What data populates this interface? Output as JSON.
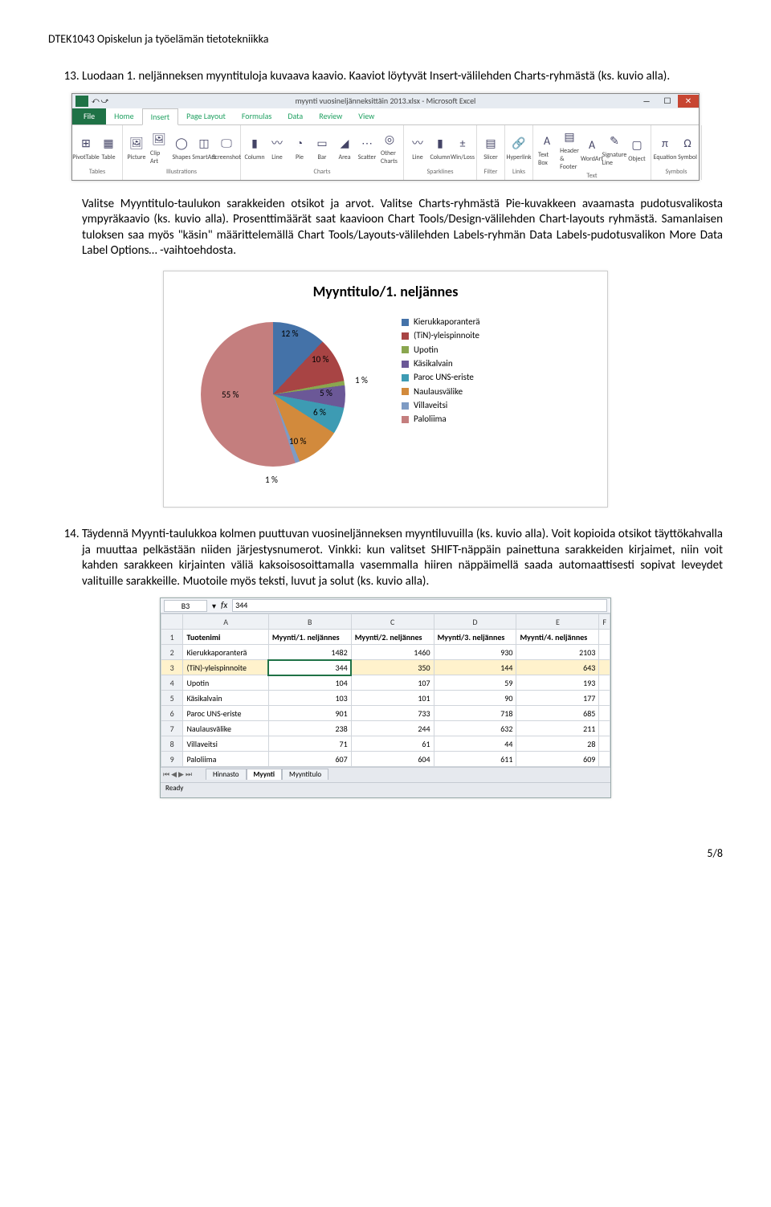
{
  "page": {
    "header": "DTEK1043 Opiskelun ja työelämän tietotekniikka",
    "footer": "5/8"
  },
  "items": {
    "n13": "Luodaan 1. neljänneksen myyntituloja kuvaava kaavio. Kaaviot löytyvät Insert-välilehden Charts-ryhmästä (ks. kuvio alla).",
    "p13b": "Valitse Myyntitulo-taulukon sarakkeiden otsikot ja arvot. Valitse Charts-ryhmästä Pie-kuvakkeen avaamasta pudotusvalikosta ympyräkaavio (ks. kuvio alla). Prosenttimäärät saat kaavioon Chart Tools/Design-välilehden Chart-layouts ryhmästä. Samanlaisen tuloksen saa myös \"käsin\" määrittelemällä Chart Tools/Layouts-välilehden Labels-ryhmän Data Labels-pudotusvalikon More Data Label Options… -vaihtoehdosta.",
    "n14": "Täydennä Myynti-taulukkoa kolmen puuttuvan vuosineljänneksen myyntiluvuilla (ks. kuvio alla). Voit kopioida otsikot täyttökahvalla ja muuttaa pelkästään niiden järjestysnumerot. Vinkki: kun valitset SHIFT-näppäin painettuna sarakkeiden kirjaimet, niin voit kahden sarakkeen kirjainten väliä kaksoisosoittamalla vasemmalla hiiren näppäimellä saada automaattisesti sopivat leveydet valituille sarakkeille. Muotoile myös teksti, luvut ja solut (ks. kuvio alla)."
  },
  "ribbon": {
    "title": "myynti vuosineljänneksittäin 2013.xlsx - Microsoft Excel",
    "tabs": [
      "File",
      "Home",
      "Insert",
      "Page Layout",
      "Formulas",
      "Data",
      "Review",
      "View"
    ],
    "active_tab": "Insert",
    "groups": [
      {
        "label": "Tables",
        "icons": [
          {
            "g": "⊞",
            "l": "PivotTable"
          },
          {
            "g": "▦",
            "l": "Table"
          }
        ]
      },
      {
        "label": "Illustrations",
        "icons": [
          {
            "g": "🖼",
            "l": "Picture"
          },
          {
            "g": "🖼",
            "l": "Clip Art"
          },
          {
            "g": "◯",
            "l": "Shapes"
          },
          {
            "g": "◫",
            "l": "SmartArt"
          },
          {
            "g": "🖵",
            "l": "Screenshot"
          }
        ]
      },
      {
        "label": "Charts",
        "icons": [
          {
            "g": "▮",
            "l": "Column"
          },
          {
            "g": "〰",
            "l": "Line"
          },
          {
            "g": "◔",
            "l": "Pie"
          },
          {
            "g": "▭",
            "l": "Bar"
          },
          {
            "g": "◢",
            "l": "Area"
          },
          {
            "g": "⋯",
            "l": "Scatter"
          },
          {
            "g": "◎",
            "l": "Other Charts"
          }
        ]
      },
      {
        "label": "Sparklines",
        "icons": [
          {
            "g": "〰",
            "l": "Line"
          },
          {
            "g": "▮",
            "l": "Column"
          },
          {
            "g": "±",
            "l": "Win/Loss"
          }
        ]
      },
      {
        "label": "Filter",
        "icons": [
          {
            "g": "▤",
            "l": "Slicer"
          }
        ]
      },
      {
        "label": "Links",
        "icons": [
          {
            "g": "🔗",
            "l": "Hyperlink"
          }
        ]
      },
      {
        "label": "Text",
        "icons": [
          {
            "g": "A",
            "l": "Text Box"
          },
          {
            "g": "▤",
            "l": "Header & Footer"
          },
          {
            "g": "A",
            "l": "WordArt"
          },
          {
            "g": "✎",
            "l": "Signature Line"
          },
          {
            "g": "▢",
            "l": "Object"
          }
        ]
      },
      {
        "label": "Symbols",
        "icons": [
          {
            "g": "π",
            "l": "Equation"
          },
          {
            "g": "Ω",
            "l": "Symbol"
          }
        ]
      }
    ]
  },
  "chart_data": {
    "type": "pie",
    "title": "Myyntitulo/1. neljännes",
    "series": [
      {
        "name": "Kierukkaporanterä",
        "value_pct": 12,
        "color": "#4472a8"
      },
      {
        "name": "(TiN)-yleispinnoite",
        "value_pct": 10,
        "color": "#a84444"
      },
      {
        "name": "Upotin",
        "value_pct": 1,
        "color": "#8aa64f"
      },
      {
        "name": "Käsikalvain",
        "value_pct": 5,
        "color": "#6b5897"
      },
      {
        "name": "Paroc UNS-eriste",
        "value_pct": 6,
        "color": "#3d9bb3"
      },
      {
        "name": "Naulausvälike",
        "value_pct": 10,
        "color": "#d28a3c"
      },
      {
        "name": "Villaveitsi",
        "value_pct": 1,
        "color": "#7e9bc4"
      },
      {
        "name": "Paloliima",
        "value_pct": 55,
        "color": "#c47e7e"
      }
    ],
    "labels_shown": [
      "12 %",
      "10 %",
      "1 %",
      "5 %",
      "6 %",
      "10 %",
      "1 %",
      "55 %"
    ]
  },
  "sheet": {
    "active_ref": "B3",
    "formula_value": "344",
    "columns": [
      "",
      "A",
      "B",
      "C",
      "D",
      "E",
      "F"
    ],
    "header_row": [
      "1",
      "Tuotenimi",
      "Myynti/1. neljännes",
      "Myynti/2. neljännes",
      "Myynti/3. neljännes",
      "Myynti/4. neljännes",
      ""
    ],
    "rows": [
      [
        "2",
        "Kierukkaporanterä",
        "1482",
        "1460",
        "930",
        "2103",
        ""
      ],
      [
        "3",
        "(TiN)-yleispinnoite",
        "344",
        "350",
        "144",
        "643",
        ""
      ],
      [
        "4",
        "Upotin",
        "104",
        "107",
        "59",
        "193",
        ""
      ],
      [
        "5",
        "Käsikalvain",
        "103",
        "101",
        "90",
        "177",
        ""
      ],
      [
        "6",
        "Paroc UNS-eriste",
        "901",
        "733",
        "718",
        "685",
        ""
      ],
      [
        "7",
        "Naulausvälike",
        "238",
        "244",
        "632",
        "211",
        ""
      ],
      [
        "8",
        "Villaveitsi",
        "71",
        "61",
        "44",
        "28",
        ""
      ],
      [
        "9",
        "Paloliima",
        "607",
        "604",
        "611",
        "609",
        ""
      ]
    ],
    "tabs": [
      "Hinnasto",
      "Myynti",
      "Myyntitulo"
    ],
    "active_sheet": "Myynti",
    "status": "Ready"
  }
}
